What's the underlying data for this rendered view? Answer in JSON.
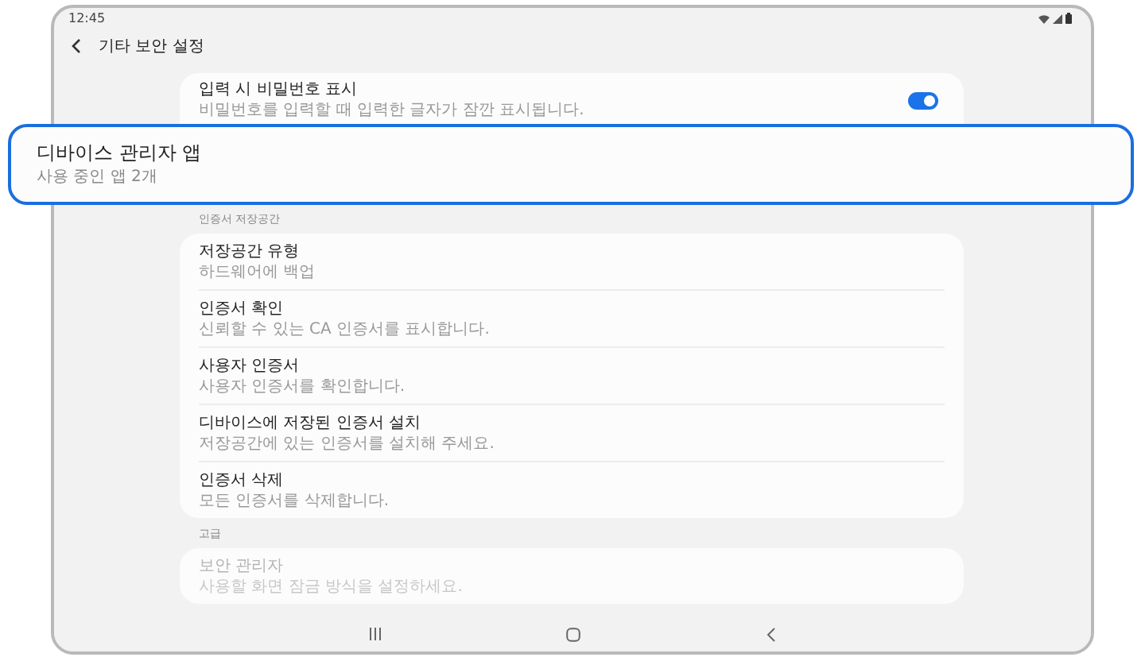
{
  "status_bar": {
    "time": "12:45"
  },
  "header": {
    "title": "기타 보안 설정"
  },
  "sections": [
    {
      "items": [
        {
          "kind": "toggle",
          "title": "입력 시 비밀번호 표시",
          "subtitle": "비밀번호를 입력할 때 입력한 글자가 잠깐 표시됩니다.",
          "on": true,
          "disabled": false
        }
      ]
    },
    {
      "label": "인증서 저장공간",
      "items": [
        {
          "kind": "plain",
          "title": "저장공간 유형",
          "subtitle": "하드웨어에 백업",
          "disabled": false
        },
        {
          "kind": "plain",
          "title": "인증서 확인",
          "subtitle": "신뢰할 수 있는 CA 인증서를 표시합니다.",
          "disabled": false
        },
        {
          "kind": "plain",
          "title": "사용자 인증서",
          "subtitle": "사용자 인증서를 확인합니다.",
          "disabled": false
        },
        {
          "kind": "plain",
          "title": "디바이스에 저장된 인증서 설치",
          "subtitle": "저장공간에 있는 인증서를 설치해 주세요.",
          "disabled": false
        },
        {
          "kind": "plain",
          "title": "인증서 삭제",
          "subtitle": "모든 인증서를 삭제합니다.",
          "disabled": false
        }
      ]
    },
    {
      "label": "고급",
      "items": [
        {
          "kind": "plain",
          "title": "보안 관리자",
          "subtitle": "사용할 화면 잠금 방식을 설정하세요.",
          "disabled": true
        }
      ]
    }
  ],
  "callout": {
    "title": "디바이스 관리자 앱",
    "subtitle": "사용 중인 앱 2개"
  }
}
